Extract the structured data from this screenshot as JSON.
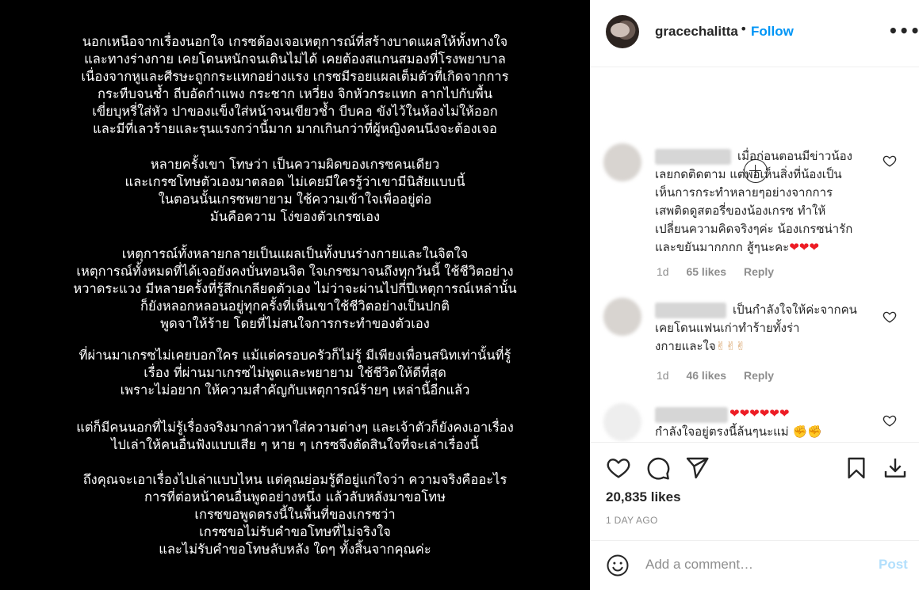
{
  "post_image": {
    "paragraphs": [
      [
        "นอกเหนือจากเรื่องนอกใจ เกรซต้องเจอเหตุการณ์ที่สร้างบาดแผลให้ทั้งทางใจ",
        "และทางร่างกาย เคยโดนหนักจนเดินไม่ได้ เคยต้องสแกนสมองที่โรงพยาบาล",
        "เนื่องจากหูและศีรษะถูกกระแทกอย่างแรง เกรซมีรอยแผลเต็มตัวที่เกิดจากการ",
        "กระทืบจนช้ำ ถีบอัดกำแพง กระชาก เหวี่ยง จิกหัวกระแทก ลากไปกับพื้น",
        "เขี่ยบุหรี่ใส่หัว ปาของแข็งใส่หน้าจนเขียวช้ำ บีบคอ ขังไว้ในห้องไม่ให้ออก",
        "และมีที่เลวร้ายและรุนแรงกว่านี้มาก มากเกินกว่าที่ผู้หญิงคนนึงจะต้องเจอ"
      ],
      [
        "หลายครั้งเขา โทษว่า เป็นความผิดของเกรซคนเดียว",
        "และเกรซโทษตัวเองมาตลอด ไม่เคยมีใครรู้ว่าเขามีนิสัยแบบนี้",
        "ในตอนนั้นเกรซพยายาม ใช้ความเข้าใจเพื่ออยู่ต่อ",
        "มันคือความ โง่ของตัวเกรซเอง"
      ],
      [
        "เหตุการณ์ทั้งหลายกลายเป็นแผลเป็นทั้งบนร่างกายและในจิตใจ",
        "เหตุการณ์ทั้งหมดที่ได้เจอยังคงบั่นทอนจิต ใจเกรซมาจนถึงทุกวันนี้ ใช้ชีวิตอย่าง",
        "หวาดระแวง มีหลายครั้งที่รู้สึกเกลียดตัวเอง ไม่ว่าจะผ่านไปกี่ปีเหตุการณ์เหล่านั้น",
        "ก็ยังหลอกหลอนอยู่ทุกครั้งที่เห็นเขาใช้ชีวิตอย่างเป็นปกติ",
        "พูดจาให้ร้าย โดยที่ไม่สนใจการกระทำของตัวเอง"
      ],
      [
        "ที่ผ่านมาเกรซไม่เคยบอกใคร แม้แต่ครอบครัวก็ไม่รู้ มีเพียงเพื่อนสนิทเท่านั้นที่รู้",
        "เรื่อง ที่ผ่านมาเกรซไม่พูดและพยายาม ใช้ชีวิตให้ดีที่สุด",
        "เพราะไม่อยาก ให้ความสำคัญกับเหตุการณ์ร้ายๆ เหล่านี้อีกแล้ว"
      ],
      [
        "แต่ก็มีคนนอกที่ไม่รู้เรื่องจริงมากล่าวหาใส่ความต่างๆ และเจ้าตัวก็ยังคงเอาเรื่อง",
        "ไปเล่าให้คนอื่นฟังแบบเสีย ๆ หาย ๆ เกรซจึงตัดสินใจที่จะเล่าเรื่องนี้"
      ],
      [
        "ถึงคุณจะเอาเรื่องไปเล่าแบบไหน แต่คุณย่อมรู้ดีอยู่แก่ใจว่า ความจริงคืออะไร",
        "การที่ต่อหน้าคนอื่นพูดอย่างหนึ่ง แล้วลับหลังมาขอโทษ",
        "เกรซขอพูดตรงนี้ในพื้นที่ของเกรซว่า",
        "เกรซขอไม่รับคำขอโทษที่ไม่จริงใจ",
        "และไม่รับคำขอโทษลับหลัง ใดๆ ทั้งสิ้นจากคุณค่ะ"
      ]
    ]
  },
  "header": {
    "username": "gracechalitta",
    "separator": "•",
    "follow_label": "Follow",
    "more_label": "•••"
  },
  "comments": [
    {
      "text_lines": [
        "เมื่อก่อนตอนมีข่าวน้อง",
        "เลยกดติดตาม แต่พอเห็นสิ่งที่น้องเป็น",
        "เห็นการกระทำหลายๆอย่างจากการ",
        "เสพติดดูสตอรี่ของน้องเกรซ ทำให้",
        "เปลี่ยนความคิดจริงๆค่ะ น้องเกรซน่ารัก",
        "และขยันมากกกก สู้ๆนะคะ"
      ],
      "emoji_tail": "❤❤❤",
      "time": "1d",
      "likes": "65 likes",
      "reply": "Reply"
    },
    {
      "text_lines": [
        "เป็นกำลังใจให้ค่ะจากคน",
        "เคยโดนแฟนเก่าทำร้ายทั้งร่า",
        "งกายและใจ"
      ],
      "emoji_tail": "✌✌✌",
      "time": "1d",
      "likes": "46 likes",
      "reply": "Reply"
    },
    {
      "emoji_head": "❤❤❤❤❤❤",
      "text_lines": [
        "กำลังใจอยู่ตรงนี้ล้นๆนะแม่"
      ],
      "emoji_tail": "✊✊"
    }
  ],
  "actions": {
    "likes_count": "20,835 likes",
    "time_ago": "1 DAY AGO",
    "comment_placeholder": "Add a comment…",
    "post_label": "Post"
  }
}
